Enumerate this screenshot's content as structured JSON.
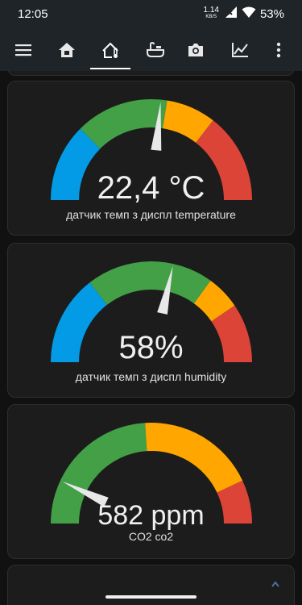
{
  "status_bar": {
    "time": "12:05",
    "net_speed_value": "1.14",
    "net_speed_unit": "KB/S",
    "battery": "53%"
  },
  "app_bar": {
    "tabs": [
      {
        "icon": "menu-icon",
        "active": false
      },
      {
        "icon": "home-icon",
        "active": false
      },
      {
        "icon": "thermometer-home-icon",
        "active": true
      },
      {
        "icon": "bathtub-icon",
        "active": false
      },
      {
        "icon": "camera-icon",
        "active": false
      },
      {
        "icon": "chart-line-icon",
        "active": false
      },
      {
        "icon": "more-vert-icon",
        "active": false
      }
    ]
  },
  "gauges": [
    {
      "value_text": "22,4 °C",
      "name": "датчик темп з диспл temperature",
      "needle_fraction": 0.53,
      "segments": [
        {
          "from": 0.0,
          "to": 0.25,
          "color": "#039be5"
        },
        {
          "from": 0.25,
          "to": 0.55,
          "color": "#43a047"
        },
        {
          "from": 0.55,
          "to": 0.71,
          "color": "#ffa600"
        },
        {
          "from": 0.71,
          "to": 1.0,
          "color": "#db4437"
        }
      ]
    },
    {
      "value_text": "58%",
      "name": "датчик темп з диспл humidity",
      "needle_fraction": 0.57,
      "segments": [
        {
          "from": 0.0,
          "to": 0.29,
          "color": "#039be5"
        },
        {
          "from": 0.29,
          "to": 0.7,
          "color": "#43a047"
        },
        {
          "from": 0.7,
          "to": 0.81,
          "color": "#ffa600"
        },
        {
          "from": 0.81,
          "to": 1.0,
          "color": "#db4437"
        }
      ]
    },
    {
      "value_text": "582 ppm",
      "name": "CO2 co2",
      "needle_fraction": 0.14,
      "segments": [
        {
          "from": 0.0,
          "to": 0.48,
          "color": "#43a047"
        },
        {
          "from": 0.48,
          "to": 0.86,
          "color": "#ffa600"
        },
        {
          "from": 0.86,
          "to": 1.0,
          "color": "#db4437"
        }
      ]
    }
  ],
  "colors": {
    "app_bar": "#1f2428",
    "background": "#111111",
    "card": "#1c1c1c",
    "needle": "#e8e8e8"
  }
}
